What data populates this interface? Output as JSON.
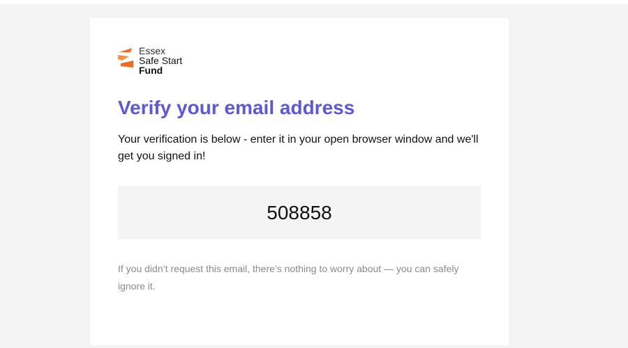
{
  "brand": {
    "line1": "Essex",
    "line2": "Safe Start",
    "line3": "Fund",
    "logo_color": "#f26a22"
  },
  "heading": "Verify your email address",
  "heading_color": "#5b57e0",
  "intro": "Your verification is below - enter it in your open browser window and we'll get you signed in!",
  "code": "508858",
  "note": "If you didn’t request this email, there’s nothing to worry about — you can safely ignore it."
}
